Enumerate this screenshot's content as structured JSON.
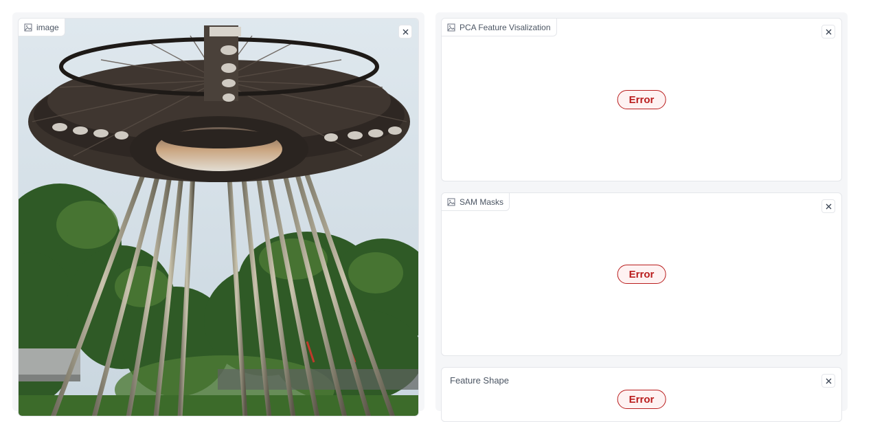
{
  "image_panel": {
    "label": "image",
    "icon": "image-icon",
    "close_icon": "close-icon"
  },
  "pca_panel": {
    "label": "PCA Feature Visalization",
    "icon": "image-icon",
    "status": "Error"
  },
  "sam_panel": {
    "label": "SAM Masks",
    "icon": "image-icon",
    "status": "Error"
  },
  "feature_panel": {
    "label": "Feature Shape",
    "status": "Error"
  },
  "colors": {
    "error": "#b91c1c",
    "panel_border": "#e4e6ea",
    "background": "#f5f6f8"
  }
}
